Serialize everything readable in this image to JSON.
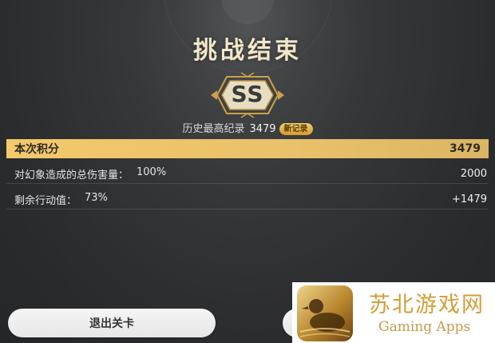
{
  "header": {
    "title": "挑战结束"
  },
  "rank": {
    "grade": "SS"
  },
  "best": {
    "label": "历史最高纪录",
    "value": "3479",
    "badge": "新记录"
  },
  "score": {
    "label": "本次积分",
    "value": "3479"
  },
  "details": [
    {
      "label": "对幻象造成的总伤害量：",
      "percent": "100%",
      "value": "2000"
    },
    {
      "label": "剩余行动值：",
      "percent": "73%",
      "value": "+1479"
    }
  ],
  "buttons": {
    "exit_label": "退出关卡"
  },
  "watermark": {
    "title": "苏北游戏网",
    "subtitle": "Gaming Apps"
  },
  "colors": {
    "accent_gold": "#e9c16b",
    "background": "#2f3133"
  }
}
